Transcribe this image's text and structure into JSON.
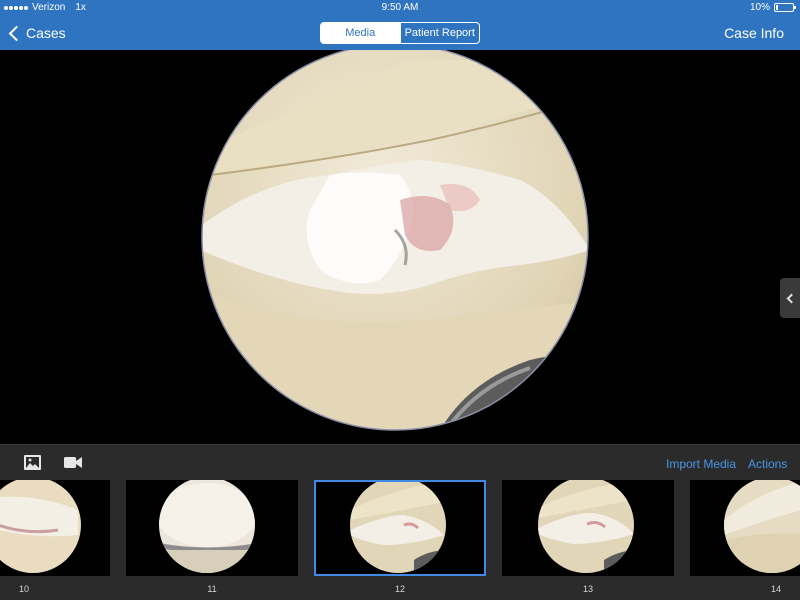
{
  "status_bar": {
    "carrier": "Verizon",
    "zoom": "1x",
    "time": "9:50 AM",
    "battery": "10%",
    "battery_level": 0.1
  },
  "nav": {
    "back_label": "Cases",
    "segments": [
      {
        "label": "Media",
        "active": true
      },
      {
        "label": "Patient Report",
        "active": false
      }
    ],
    "right_label": "Case Info"
  },
  "toolbar": {
    "import_label": "Import Media",
    "actions_label": "Actions"
  },
  "thumbnails": [
    {
      "number": "10",
      "selected": false
    },
    {
      "number": "11",
      "selected": false
    },
    {
      "number": "12",
      "selected": true
    },
    {
      "number": "13",
      "selected": false
    },
    {
      "number": "14",
      "selected": false
    }
  ],
  "colors": {
    "nav_blue": "#2f74c0",
    "link_blue": "#4a95e6",
    "selection_blue": "#3d8be6",
    "toolbar_bg": "#2b2b2b"
  },
  "icons": {
    "back": "chevron-left-icon",
    "photo": "photo-icon",
    "video": "video-camera-icon",
    "drawer": "chevron-left-icon"
  }
}
